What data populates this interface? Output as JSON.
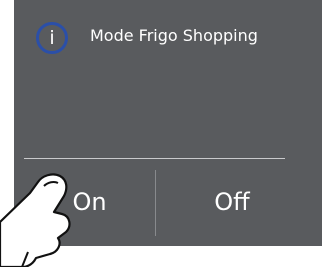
{
  "dialog": {
    "info_glyph": "i",
    "info_icon": "info-icon",
    "title": "Mode Frigo Shopping"
  },
  "buttons": {
    "on_label": "On",
    "off_label": "Off"
  },
  "overlay": {
    "gesture_icon": "finger-tap-icon"
  },
  "colors": {
    "panel_background": "#595b5e",
    "text": "#ffffff",
    "info_ring": "#2b4fa8",
    "divider": "#c9cacc"
  }
}
